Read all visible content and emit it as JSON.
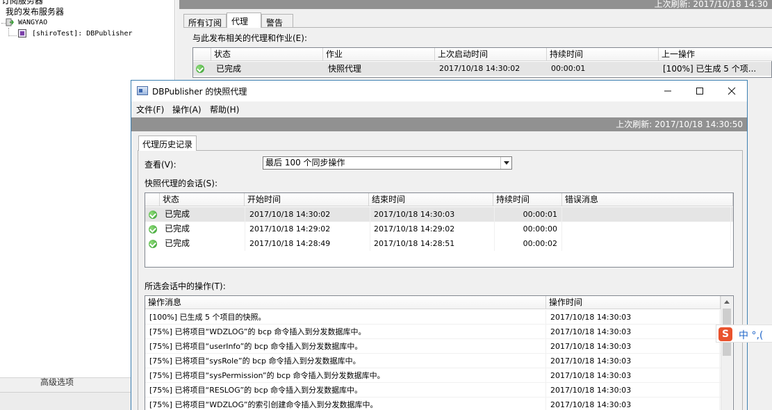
{
  "tree": {
    "items": [
      {
        "label": "订阅服务器"
      },
      {
        "label": "我的发布服务器"
      },
      {
        "label": "WANGYAO"
      },
      {
        "label": "[shiroTest]: DBPublisher"
      }
    ],
    "advanced": "高级选项"
  },
  "monitor": {
    "refresh": "上次刷新: 2017/10/18 14:30",
    "tabs": [
      {
        "label": "所有订阅"
      },
      {
        "label": "代理"
      },
      {
        "label": "警告"
      }
    ],
    "caption": "与此发布相关的代理和作业(E):",
    "columns": [
      "状态",
      "作业",
      "上次启动时间",
      "持续时间",
      "上一操作"
    ],
    "row": {
      "status": "已完成",
      "job": "快照代理",
      "start": "2017/10/18 14:30:02",
      "duration": "00:00:01",
      "action": "[100%] 已生成 5 个项..."
    }
  },
  "dialog": {
    "title": "DBPublisher 的快照代理",
    "menu": [
      "文件(F)",
      "操作(A)",
      "帮助(H)"
    ],
    "refresh": "上次刷新: 2017/10/18 14:30:50",
    "tab": "代理历史记录",
    "view_label": "查看(V):",
    "view_value": "最后 100 个同步操作",
    "sessions_label": "快照代理的会话(S):",
    "session_columns": [
      "状态",
      "开始时间",
      "结束时间",
      "持续时间",
      "错误消息"
    ],
    "sessions": [
      {
        "status": "已完成",
        "start": "2017/10/18 14:30:02",
        "end": "2017/10/18 14:30:03",
        "duration": "00:00:01",
        "error": ""
      },
      {
        "status": "已完成",
        "start": "2017/10/18 14:29:02",
        "end": "2017/10/18 14:29:02",
        "duration": "00:00:00",
        "error": ""
      },
      {
        "status": "已完成",
        "start": "2017/10/18 14:28:49",
        "end": "2017/10/18 14:28:51",
        "duration": "00:00:02",
        "error": ""
      }
    ],
    "actions_label": "所选会话中的操作(T):",
    "action_columns": [
      "操作消息",
      "操作时间"
    ],
    "actions": [
      {
        "message": "[100%] 已生成 5 个项目的快照。",
        "time": "2017/10/18 14:30:03"
      },
      {
        "message": "[75%] 已将项目“WDZLOG”的 bcp 命令插入到分发数据库中。",
        "time": "2017/10/18 14:30:03"
      },
      {
        "message": "[75%] 已将项目“userInfo”的 bcp 命令插入到分发数据库中。",
        "time": "2017/10/18 14:30:03"
      },
      {
        "message": "[75%] 已将项目“sysRole”的 bcp 命令插入到分发数据库中。",
        "time": "2017/10/18 14:30:03"
      },
      {
        "message": "[75%] 已将项目“sysPermission”的 bcp 命令插入到分发数据库中。",
        "time": "2017/10/18 14:30:03"
      },
      {
        "message": "[75%] 已将项目“RESLOG”的 bcp 命令插入到分发数据库中。",
        "time": "2017/10/18 14:30:03"
      },
      {
        "message": "[75%] 已将项目“WDZLOG”的索引创建命令插入到分发数据库中。",
        "time": "2017/10/18 14:30:03"
      }
    ]
  },
  "ime": {
    "logo": "S",
    "text": "中 °,("
  },
  "colors": {
    "status_ok": "#2e9a2a",
    "refresh_bar": "#919191",
    "selection": "#e5e5e5",
    "window_border": "#3c7fb1"
  }
}
